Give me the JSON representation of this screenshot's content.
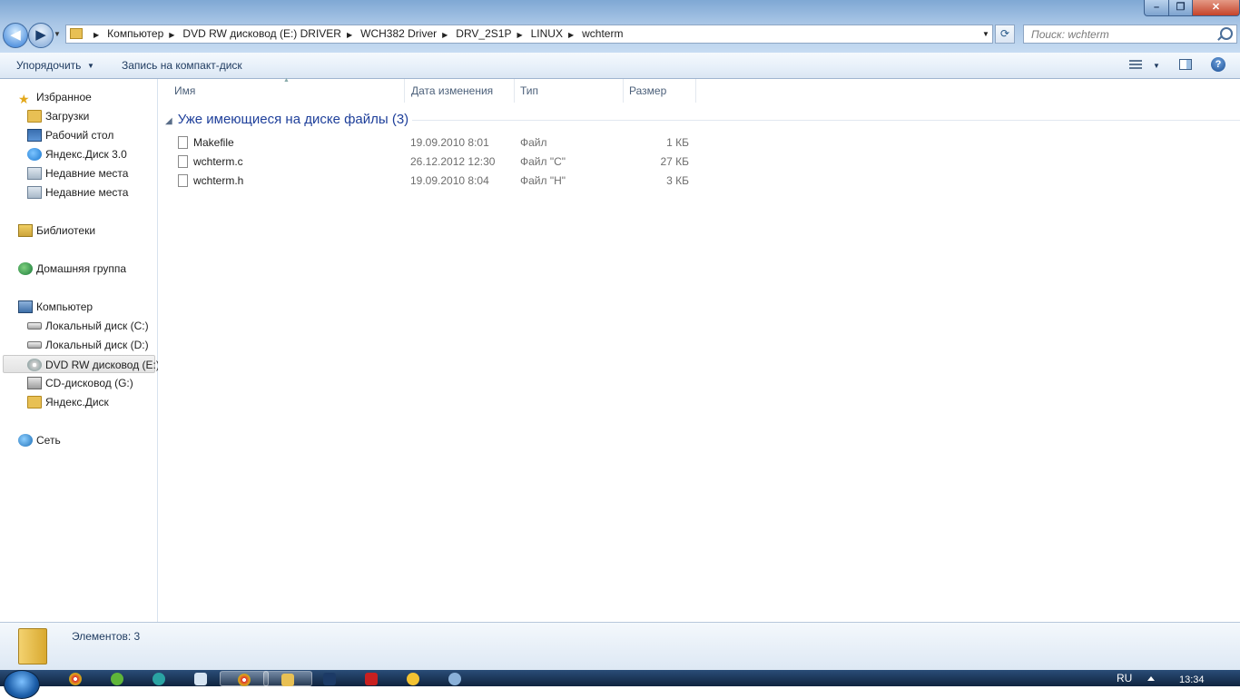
{
  "window": {
    "controls": {
      "minimize": "–",
      "maximize": "❐",
      "close": "✕"
    }
  },
  "address": {
    "crumbs": [
      "Компьютер",
      "DVD RW дисковод (E:) DRIVER",
      "WCH382 Driver",
      "DRV_2S1P",
      "LINUX",
      "wchterm"
    ]
  },
  "search": {
    "placeholder": "Поиск: wchterm"
  },
  "toolbar": {
    "organize_label": "Упорядочить",
    "burn_label": "Запись на компакт-диск",
    "help_label": "?"
  },
  "sidebar": {
    "items": [
      {
        "label": "Избранное",
        "icon": "star-icon"
      },
      {
        "label": "Загрузки",
        "icon": "downloads-folder-icon"
      },
      {
        "label": "Рабочий стол",
        "icon": "desktop-icon"
      },
      {
        "label": "Яндекс.Диск 3.0",
        "icon": "yandex-disk-icon"
      },
      {
        "label": "Недавние места",
        "icon": "recent-places-icon"
      },
      {
        "label": "Недавние места",
        "icon": "recent-places-icon"
      },
      {
        "label": "Библиотеки",
        "icon": "libraries-icon"
      },
      {
        "label": "Домашняя группа",
        "icon": "homegroup-icon"
      },
      {
        "label": "Компьютер",
        "icon": "computer-icon"
      },
      {
        "label": "Локальный диск (C:)",
        "icon": "local-disk-icon"
      },
      {
        "label": "Локальный диск (D:)",
        "icon": "local-disk-icon"
      },
      {
        "label": "DVD RW дисковод (E:)",
        "icon": "dvd-drive-icon"
      },
      {
        "label": "CD-дисковод (G:)",
        "icon": "cd-drive-icon"
      },
      {
        "label": "Яндекс.Диск",
        "icon": "folder-icon"
      },
      {
        "label": "Сеть",
        "icon": "network-icon"
      }
    ],
    "selected": "DVD RW дисковод (E:)"
  },
  "columns": {
    "name": "Имя",
    "date": "Дата изменения",
    "type": "Тип",
    "size": "Размер"
  },
  "group": {
    "title": "Уже имеющиеся на диске файлы (3)"
  },
  "files": [
    {
      "name": "Makefile",
      "date": "19.09.2010 8:01",
      "type": "Файл",
      "size": "1 КБ"
    },
    {
      "name": "wchterm.c",
      "date": "26.12.2012 12:30",
      "type": "Файл \"C\"",
      "size": "27 КБ"
    },
    {
      "name": "wchterm.h",
      "date": "19.09.2010 8:04",
      "type": "Файл \"H\"",
      "size": "3 КБ"
    }
  ],
  "details": {
    "count_label": "Элементов: 3"
  },
  "taskbar": {
    "lang": "RU",
    "clock": "13:34",
    "apps": [
      "chrome-icon",
      "utorrent-icon",
      "kaspersky-icon",
      "notepad-icon",
      "chrome-browser-icon",
      "explorer-icon",
      "photoshop-icon",
      "acrobat-icon",
      "1c-icon",
      "app-icon"
    ]
  }
}
